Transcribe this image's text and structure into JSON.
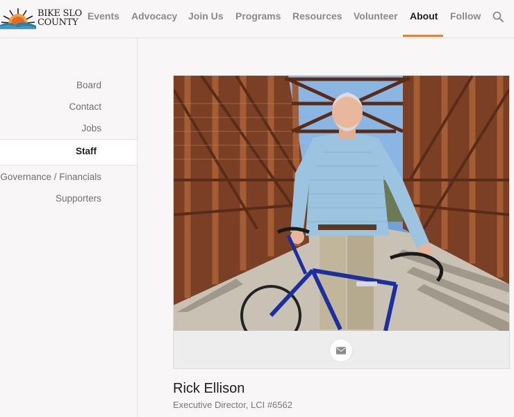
{
  "header": {
    "logo_line1": "BIKE SLO",
    "logo_line2": "COUNTY",
    "nav": [
      {
        "label": "Events"
      },
      {
        "label": "Advocacy"
      },
      {
        "label": "Join Us"
      },
      {
        "label": "Programs"
      },
      {
        "label": "Resources"
      },
      {
        "label": "Volunteer"
      },
      {
        "label": "About",
        "active": true
      },
      {
        "label": "Follow"
      }
    ]
  },
  "sidebar": {
    "items": [
      {
        "label": "Board"
      },
      {
        "label": "Contact"
      },
      {
        "label": "Jobs"
      },
      {
        "label": "Staff",
        "active": true
      },
      {
        "label": "Governance / Financials"
      },
      {
        "label": "Supporters"
      }
    ]
  },
  "staff": {
    "name": "Rick Ellison",
    "title": "Executive Director, LCI #6562"
  },
  "colors": {
    "accent": "#e0813c",
    "bridge_rust": "#8a4a2b",
    "sky": "#6fa2d8",
    "shirt": "#9cc3e0",
    "bike_frame": "#1c2fa0"
  },
  "icons": {
    "search": "magnifier",
    "mail": "envelope"
  }
}
